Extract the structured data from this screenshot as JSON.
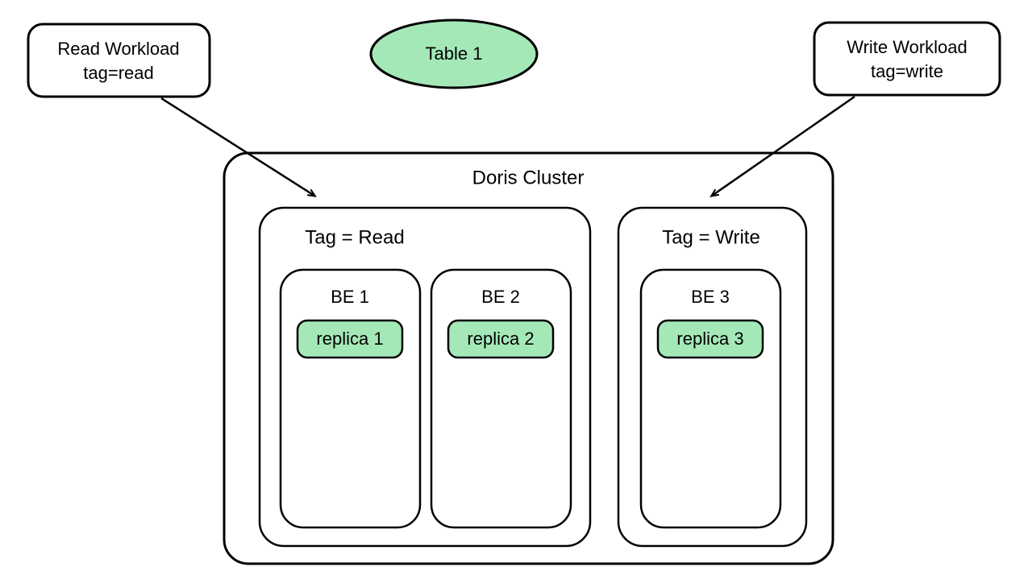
{
  "diagram": {
    "read_workload": {
      "line1": "Read Workload",
      "line2": "tag=read"
    },
    "write_workload": {
      "line1": "Write Workload",
      "line2": "tag=write"
    },
    "table": "Table 1",
    "cluster_title": "Doris Cluster",
    "tag_read": {
      "title": "Tag = Read",
      "be1": {
        "title": "BE 1",
        "replica": "replica 1"
      },
      "be2": {
        "title": "BE 2",
        "replica": "replica 2"
      }
    },
    "tag_write": {
      "title": "Tag = Write",
      "be3": {
        "title": "BE 3",
        "replica": "replica 3"
      }
    }
  }
}
